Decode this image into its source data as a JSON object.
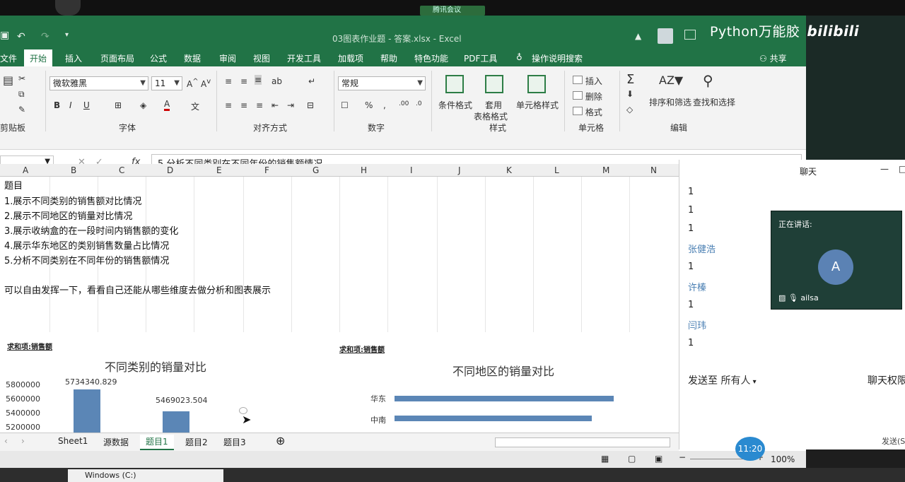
{
  "overlay": {
    "meeting": "腾讯会议",
    "watermark_text": "Python万能胶",
    "watermark_logo": "bilibili"
  },
  "excel": {
    "window_title": "03图表作业题 - 答案.xlsx - Excel",
    "tabs": [
      "文件",
      "开始",
      "插入",
      "页面布局",
      "公式",
      "数据",
      "审阅",
      "视图",
      "开发工具",
      "加载项",
      "帮助",
      "特色功能",
      "PDF工具",
      "操作说明搜索",
      "共享"
    ],
    "ribbon": {
      "clipboard_label": "剪贴板",
      "font_label": "字体",
      "alignment_label": "对齐方式",
      "number_label": "数字",
      "styles_label": "样式",
      "cells_label": "单元格",
      "editing_label": "编辑",
      "font_name": "微软雅黑",
      "font_size": "11",
      "number_format": "常规",
      "cond_format": "条件格式",
      "table_format_1": "套用",
      "table_format_2": "表格格式",
      "cell_styles": "单元格样式",
      "insert": "插入",
      "delete": "删除",
      "format": "格式",
      "sort_filter": "排序和筛选",
      "find_select": "查找和选择",
      "bold": "B",
      "italic": "I",
      "underline": "U",
      "percent": "%",
      "comma": ","
    },
    "formula_bar": {
      "fx": "fx",
      "content": "5.分析不同类别在不同年份的销售额情况"
    },
    "columns": [
      "A",
      "B",
      "C",
      "D",
      "E",
      "F",
      "G",
      "H",
      "I",
      "J",
      "K",
      "L",
      "M",
      "N"
    ],
    "cells": {
      "title": "题目",
      "q1": "1.展示不同类别的销售额对比情况",
      "q2": "2.展示不同地区的销量对比情况",
      "q3": "3.展示收纳盒的在一段时间内销售额的变化",
      "q4": "4.展示华东地区的类别销售数量占比情况",
      "q5": "5.分析不同类别在不同年份的销售额情况",
      "note": "可以自由发挥一下，看看自己还能从哪些维度去做分析和图表展示"
    },
    "pivot_label_1": "求和项:销售额",
    "pivot_label_2": "求和项:销售额",
    "sheet_tabs": [
      "Sheet1",
      "源数据",
      "题目1",
      "题目2",
      "题目3"
    ],
    "active_sheet": "题目1",
    "add_sheet": "⊕",
    "zoom": "100%"
  },
  "chart_data": [
    {
      "type": "bar",
      "title": "不同类别的销量对比",
      "y_ticks": [
        "5800000",
        "5600000",
        "5400000",
        "5200000"
      ],
      "ylim": [
        5200000,
        5800000
      ],
      "series": [
        {
          "values": [
            5734340.829,
            5469023.504
          ]
        }
      ],
      "data_labels": [
        "5734340.829",
        "5469023.504"
      ]
    },
    {
      "type": "bar",
      "orientation": "horizontal",
      "title": "不同地区的销量对比",
      "categories": [
        "华东",
        "中南"
      ],
      "series": [
        {
          "values": [
            1,
            0.9
          ]
        }
      ]
    }
  ],
  "chat": {
    "title": "聊天",
    "messages": [
      {
        "text": "1",
        "kind": "msg"
      },
      {
        "text": "1",
        "kind": "msg"
      },
      {
        "text": "1",
        "kind": "msg"
      },
      {
        "text": "张健浩",
        "kind": "name"
      },
      {
        "text": "1",
        "kind": "msg"
      },
      {
        "text": "许榛",
        "kind": "name"
      },
      {
        "text": "1",
        "kind": "msg"
      },
      {
        "text": "闫玮",
        "kind": "name"
      },
      {
        "text": "1",
        "kind": "msg"
      }
    ],
    "send_to_label": "发送至",
    "send_to_value": "所有人",
    "permission": "聊天权限",
    "send_button": "发送(S)",
    "video": {
      "speaking": "正在讲话:",
      "avatar_letter": "A",
      "user": "ailsa"
    }
  },
  "clock": "11:20",
  "taskbar": {
    "drive": "Windows (C:)"
  }
}
